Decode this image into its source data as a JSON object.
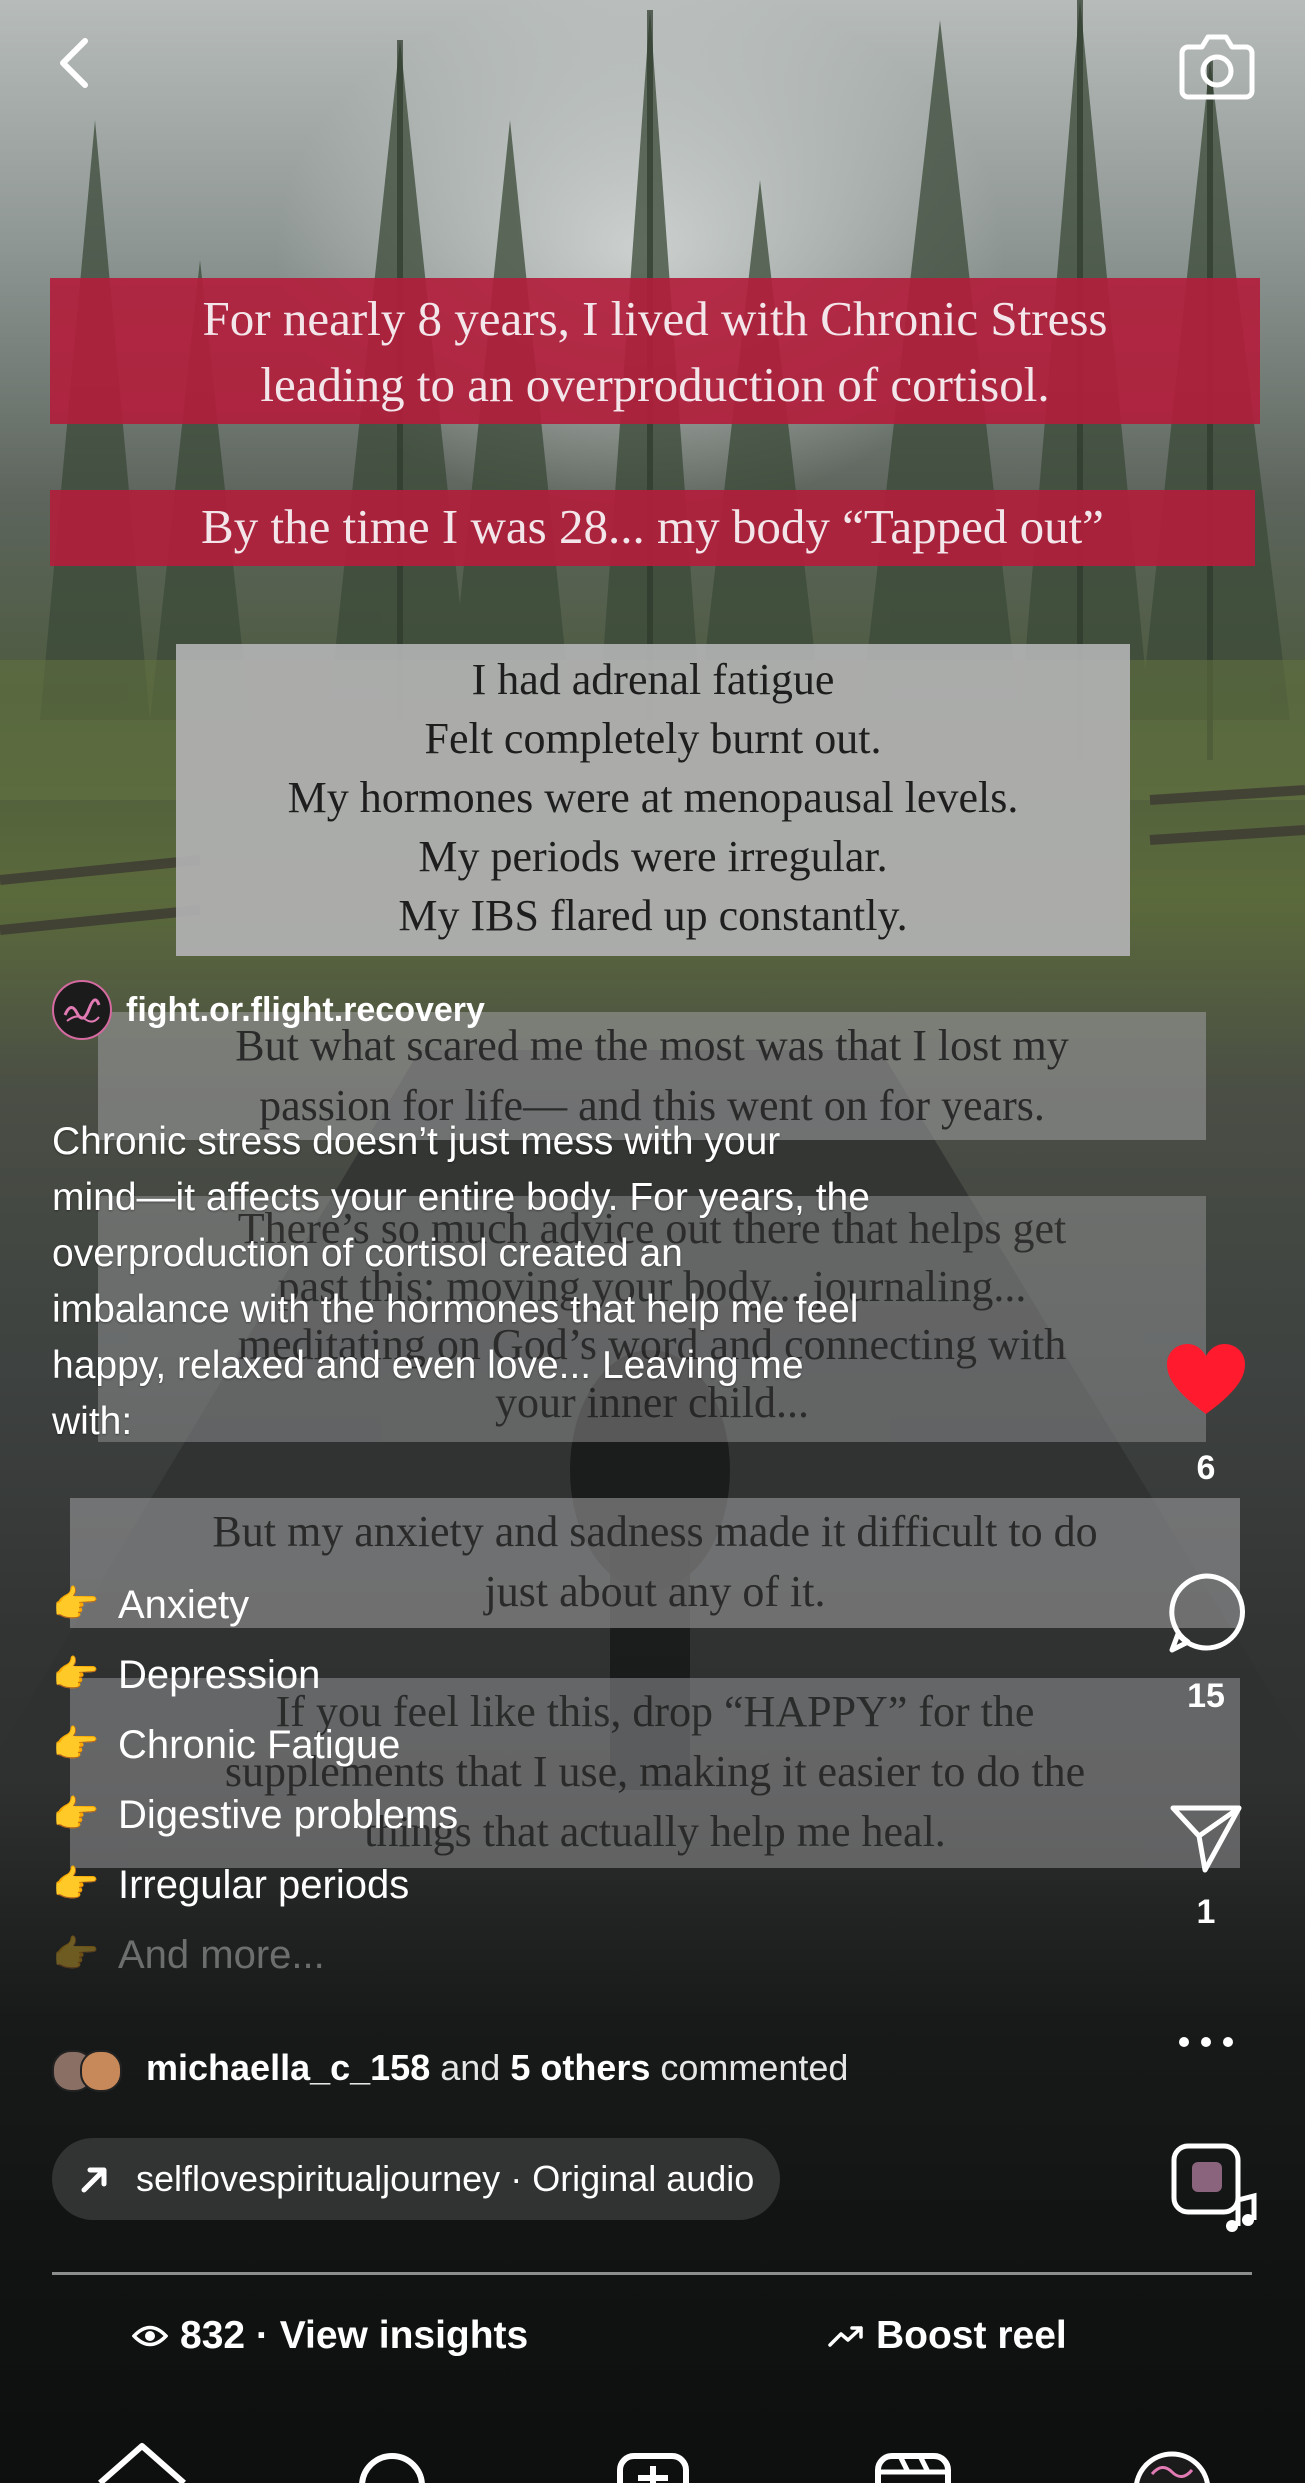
{
  "header": {
    "back_icon": "chevron-left-icon",
    "camera_icon": "camera-icon"
  },
  "reel_text": {
    "red_lines_1": [
      "For nearly 8 years, I lived with Chronic Stress",
      "leading to an overproduction of cortisol."
    ],
    "red_line_2": "By the time I was 28... my body “Tapped out”",
    "grey_lines": [
      "I had adrenal fatigue",
      "Felt completely burnt out.",
      "My hormones were at menopausal levels.",
      "My periods were irregular.",
      "My IBS flared up constantly."
    ],
    "passion_lines": [
      "But what scared me the most was that I lost my",
      "passion for life— and this went on for years."
    ],
    "advice_lines": [
      "There’s so much advice out there that helps get",
      "past this: moving your body... journaling...",
      "meditating on God’s word and connecting with",
      "your inner child..."
    ],
    "anxiety_lines": [
      "But my anxiety and sadness made it difficult to do",
      "just about any of it."
    ],
    "cta_lines": [
      "If you feel like this, drop “HAPPY” for the",
      "supplements that I use, making it easier to do the",
      "things that actually help me heal."
    ]
  },
  "post": {
    "username": "fight.or.flight.recovery",
    "caption_lines": [
      "Chronic stress doesn’t just mess with your",
      "mind—it affects your entire body. For years, the",
      "overproduction of cortisol created an",
      "imbalance with the hormones that help me feel",
      "happy, relaxed and even love... Leaving me",
      "with:"
    ],
    "bullets": [
      "Anxiety",
      "Depression",
      "Chronic Fatigue",
      "Digestive problems",
      "Irregular periods",
      "And more..."
    ],
    "bullet_icon": "pointing-hand-emoji",
    "commenters": {
      "name": "michaella_c_158",
      "and": "and",
      "others": "5 others",
      "suffix": "commented"
    },
    "audio": {
      "account": "selflovespiritualjourney",
      "separator": "·",
      "track": "Original audio"
    }
  },
  "actions": {
    "likes": "6",
    "comments": "15",
    "shares": "1",
    "liked": true,
    "like_color": "#ff1a2e"
  },
  "stats": {
    "views": "832 · View insights",
    "boost": "Boost reel"
  },
  "nav": {
    "icons": [
      "home-icon",
      "search-icon",
      "create-icon",
      "reels-icon",
      "profile-avatar"
    ]
  },
  "colors": {
    "red_box": "#b21e3c",
    "grey_box": "#b4b4b6"
  }
}
